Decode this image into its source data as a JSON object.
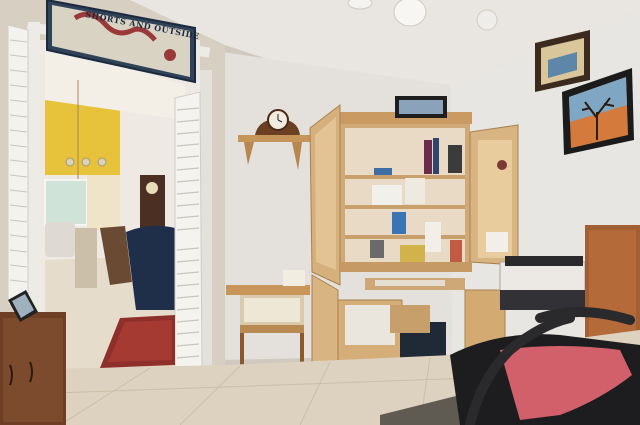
{
  "scene": {
    "description_kind": "photo",
    "subject": "home office room"
  },
  "wall_sign": {
    "text": "SHORTS AND OUTSIDE"
  },
  "colors": {
    "ceiling": "#e9e6e1",
    "wall": "#e6e3de",
    "wall_shadow": "#d3cec6",
    "floor": "#ddd2bf",
    "wood": "#d8b98c",
    "wood_dark": "#b48d5c",
    "door_white": "#f3f2ee",
    "yellow_wall": "#e7c33c",
    "chair_black": "#1d1d1f",
    "cushion_pink": "#d2606a",
    "rug_red": "#8e2f2a",
    "cabinet": "#7a4a2e"
  }
}
